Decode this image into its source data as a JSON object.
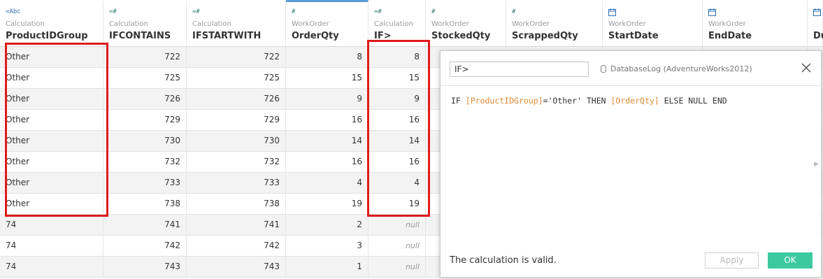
{
  "columns": [
    {
      "type_icon": "=Abc",
      "source": "Calculation",
      "name": "ProductIDGroup"
    },
    {
      "type_icon": "=#",
      "source": "Calculation",
      "name": "IFCONTAINS"
    },
    {
      "type_icon": "=#",
      "source": "Calculation",
      "name": "IFSTARTWITH"
    },
    {
      "type_icon": "#",
      "source": "WorkOrder",
      "name": "OrderQty"
    },
    {
      "type_icon": "=#",
      "source": "Calculation",
      "name": "IF>"
    },
    {
      "type_icon": "#",
      "source": "WorkOrder",
      "name": "StockedQty"
    },
    {
      "type_icon": "#",
      "source": "WorkOrder",
      "name": "ScrappedQty"
    },
    {
      "type_icon": "calendar",
      "source": "WorkOrder",
      "name": "StartDate"
    },
    {
      "type_icon": "calendar",
      "source": "WorkOrder",
      "name": "EndDate"
    },
    {
      "type_icon": "calendar",
      "source": "",
      "name": "Du"
    }
  ],
  "rows": [
    [
      "Other",
      "722",
      "722",
      "8",
      "8"
    ],
    [
      "Other",
      "725",
      "725",
      "15",
      "15"
    ],
    [
      "Other",
      "726",
      "726",
      "9",
      "9"
    ],
    [
      "Other",
      "729",
      "729",
      "16",
      "16"
    ],
    [
      "Other",
      "730",
      "730",
      "14",
      "14"
    ],
    [
      "Other",
      "732",
      "732",
      "16",
      "16"
    ],
    [
      "Other",
      "733",
      "733",
      "4",
      "4"
    ],
    [
      "Other",
      "738",
      "738",
      "19",
      "19"
    ],
    [
      "74",
      "741",
      "741",
      "2",
      "null"
    ],
    [
      "74",
      "742",
      "742",
      "3",
      "null"
    ],
    [
      "74",
      "743",
      "743",
      "1",
      "null"
    ]
  ],
  "dialog": {
    "calc_name": "IF>",
    "datasource": "DatabaseLog (AdventureWorks2012)",
    "code": {
      "kw_if": "IF ",
      "field1": "[ProductIDGroup]",
      "mid": "='Other' THEN ",
      "field2": "[OrderQty]",
      "tail": " ELSE NULL END"
    },
    "status": "The calculation is valid.",
    "apply_label": "Apply",
    "ok_label": "OK"
  },
  "colors": {
    "accent_green": "#3cc9a0",
    "highlight_red": "#e01b1b",
    "field_orange": "#e08a33"
  }
}
